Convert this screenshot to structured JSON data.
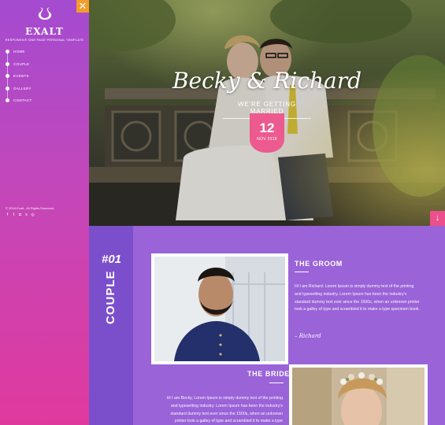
{
  "brand": {
    "name": "EXALT",
    "tagline": "RESPONSIVE ONE PAGE PERSONAL TEMPLATE"
  },
  "sidebar": {
    "nav": [
      {
        "label": "HOME"
      },
      {
        "label": "COUPLE"
      },
      {
        "label": "EVENTS"
      },
      {
        "label": "GALLERY"
      },
      {
        "label": "CONTACT"
      }
    ],
    "copyright": "© 2018 Exalt - All Rights Reserved",
    "socials": [
      "facebook-icon",
      "twitter-icon",
      "instagram-icon",
      "skype-icon",
      "dribbble-icon"
    ],
    "close_icon": "close-icon"
  },
  "hero": {
    "names": "Becky & Richard",
    "subtitle": "WE'RE GETTING MARRIED",
    "date_day": "12",
    "date_month": "NOV 2018",
    "scroll_icon": "arrow-down-icon"
  },
  "couple": {
    "number": "#01",
    "label": "COUPLE",
    "groom": {
      "heading": "THE GROOM",
      "text": "Hi I am Richard. Lorem Ipsum is simply dummy text of the printing and typesetting industry. Lorem Ipsum has been the industry's standard dummy text ever since the 1500s, when an unknown printer took a galley of type and scrambled it to make a type specimen book.",
      "signature": "– Richard"
    },
    "bride": {
      "heading": "THE BRIDE",
      "text": "Hi I am Becky, Lorem Ipsum is simply dummy text of the printing and typesetting industry. Lorem Ipsum has been the industry's standard dummy text ever since the 1500s, when an unknown printer took a galley of type and scrambled it to make a type"
    }
  },
  "colors": {
    "accent_orange": "#f39c2d",
    "accent_pink": "#ec4f8c",
    "section_purple": "#9a63d8"
  }
}
